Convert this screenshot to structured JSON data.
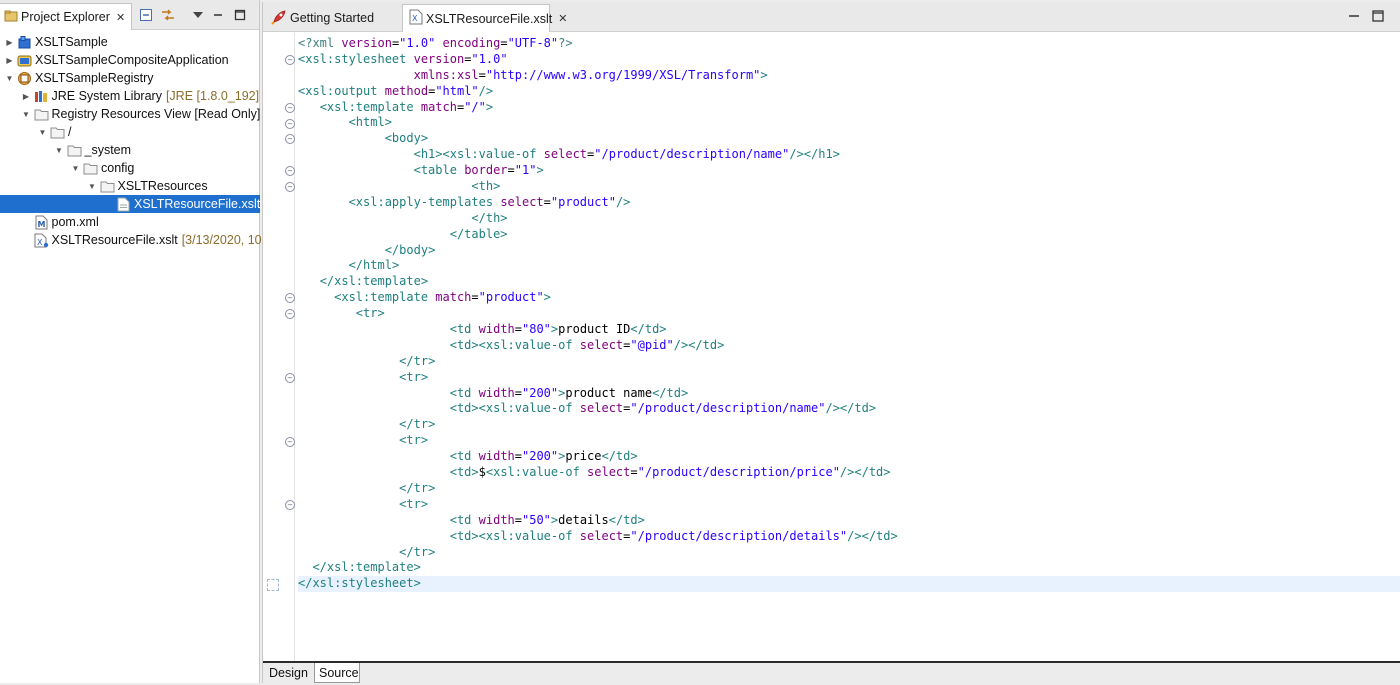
{
  "explorer": {
    "tab_label": "Project Explorer",
    "tree": [
      {
        "label": "XSLTSample",
        "suffix": "",
        "indent": 0,
        "twisty": "closed",
        "icon": "project-icon"
      },
      {
        "label": "XSLTSampleCompositeApplication",
        "suffix": "",
        "indent": 0,
        "twisty": "closed",
        "icon": "composite-app-icon"
      },
      {
        "label": "XSLTSampleRegistry",
        "suffix": "",
        "indent": 0,
        "twisty": "open",
        "icon": "registry-project-icon"
      },
      {
        "label": "JRE System Library",
        "suffix": "[JRE [1.8.0_192]",
        "indent": 1,
        "twisty": "closed",
        "icon": "library-icon"
      },
      {
        "label": "Registry Resources View [Read Only]",
        "suffix": "",
        "indent": 1,
        "twisty": "open",
        "icon": "folder-icon"
      },
      {
        "label": "/",
        "suffix": "",
        "indent": 2,
        "twisty": "open",
        "icon": "folder-icon"
      },
      {
        "label": "_system",
        "suffix": "",
        "indent": 3,
        "twisty": "open",
        "icon": "folder-icon"
      },
      {
        "label": "config",
        "suffix": "",
        "indent": 4,
        "twisty": "open",
        "icon": "folder-icon"
      },
      {
        "label": "XSLTResources",
        "suffix": "",
        "indent": 5,
        "twisty": "open",
        "icon": "folder-icon"
      },
      {
        "label": "XSLTResourceFile.xslt",
        "suffix": "",
        "indent": 6,
        "twisty": "none",
        "icon": "file-icon",
        "selected": true
      },
      {
        "label": "pom.xml",
        "suffix": "",
        "indent": 1,
        "twisty": "none",
        "icon": "maven-icon"
      },
      {
        "label": "XSLTResourceFile.xslt",
        "suffix": "[3/13/2020, 10",
        "indent": 1,
        "twisty": "none",
        "icon": "xslt-file-icon"
      }
    ]
  },
  "editor": {
    "tabs": [
      {
        "label": "Getting Started",
        "icon": "rocket-icon"
      },
      {
        "label": "XSLTResourceFile.xslt",
        "icon": "xslt-file-icon",
        "active": true
      }
    ],
    "bottom_tabs": [
      "Design",
      "Source"
    ],
    "lines": [
      "<?xml version=\"1.0\" encoding=\"UTF-8\"?>",
      "<xsl:stylesheet version=\"1.0\"",
      "                xmlns:xsl=\"http://www.w3.org/1999/XSL/Transform\">",
      "<xsl:output method=\"html\"/>",
      "   <xsl:template match=\"/\">",
      "       <html>",
      "            <body>",
      "                <h1><xsl:value-of select=\"/product/description/name\"/></h1>",
      "                <table border=\"1\">",
      "                        <th>",
      "       <xsl:apply-templates select=\"product\"/>",
      "                        </th>",
      "                     </table>",
      "            </body>",
      "       </html>",
      "   </xsl:template>",
      "     <xsl:template match=\"product\">",
      "        <tr>",
      "                     <td width=\"80\">product ID</td>",
      "                     <td><xsl:value-of select=\"@pid\"/></td>",
      "              </tr>",
      "              <tr>",
      "                     <td width=\"200\">product name</td>",
      "                     <td><xsl:value-of select=\"/product/description/name\"/></td>",
      "              </tr>",
      "              <tr>",
      "                     <td width=\"200\">price</td>",
      "                     <td>$<xsl:value-of select=\"/product/description/price\"/></td>",
      "              </tr>",
      "              <tr>",
      "                     <td width=\"50\">details</td>",
      "                     <td><xsl:value-of select=\"/product/description/details\"/></td>",
      "              </tr>",
      "  </xsl:template>",
      "</xsl:stylesheet>"
    ],
    "fold_lines": [
      1,
      4,
      5,
      6,
      8,
      9,
      16,
      17,
      21,
      25,
      29
    ]
  },
  "colors": {
    "tag": "#1f7f7f",
    "attribute": "#7f007f",
    "value": "#2a00ff",
    "selection": "#1f6fcf",
    "current_line": "#e8f2fe"
  }
}
